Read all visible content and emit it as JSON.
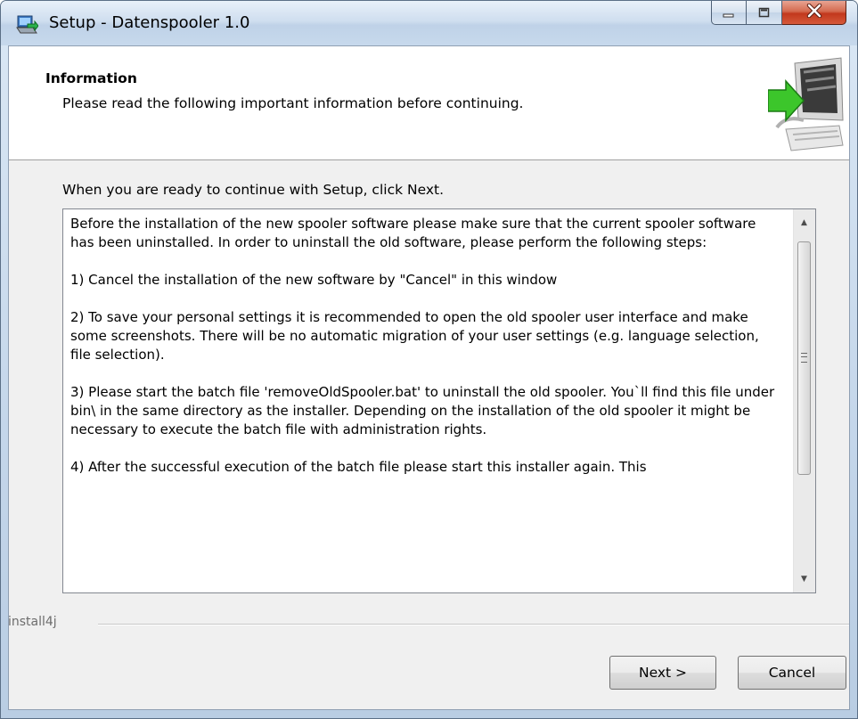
{
  "window": {
    "title": "Setup - Datenspooler 1.0"
  },
  "header": {
    "title": "Information",
    "subtitle": "Please read the following important information before continuing."
  },
  "main": {
    "instruction": "When you are ready to continue with Setup, click Next.",
    "info_text": "Before the installation of the new spooler software please make sure that the current spooler software has been uninstalled. In order to uninstall the old software, please perform the following steps:\n\n1) Cancel the installation of the new software by \"Cancel\" in this window\n\n2) To save your personal settings it is recommended to open the old spooler user interface and make some screenshots. There will be no automatic migration of your user settings (e.g. language selection, file selection).\n\n3) Please start the batch file 'removeOldSpooler.bat' to uninstall the old spooler. You`ll find this file under bin\\ in the same directory as the installer. Depending on the installation of the old spooler it might be necessary to execute the batch file with administration rights.\n\n4) After the successful execution of the batch file please start this installer again. This"
  },
  "footer": {
    "brand": "install4j",
    "next_label": "Next >",
    "cancel_label": "Cancel"
  },
  "colors": {
    "titlebar": "#c7d9ec",
    "close_button": "#c2381d",
    "header_bg": "#ffffff",
    "body_bg": "#f0f0f0"
  },
  "icons": [
    "setup-app-icon",
    "minimize-icon",
    "maximize-icon",
    "close-icon",
    "computer-arrow-icon",
    "scroll-up-icon",
    "scroll-down-icon"
  ]
}
